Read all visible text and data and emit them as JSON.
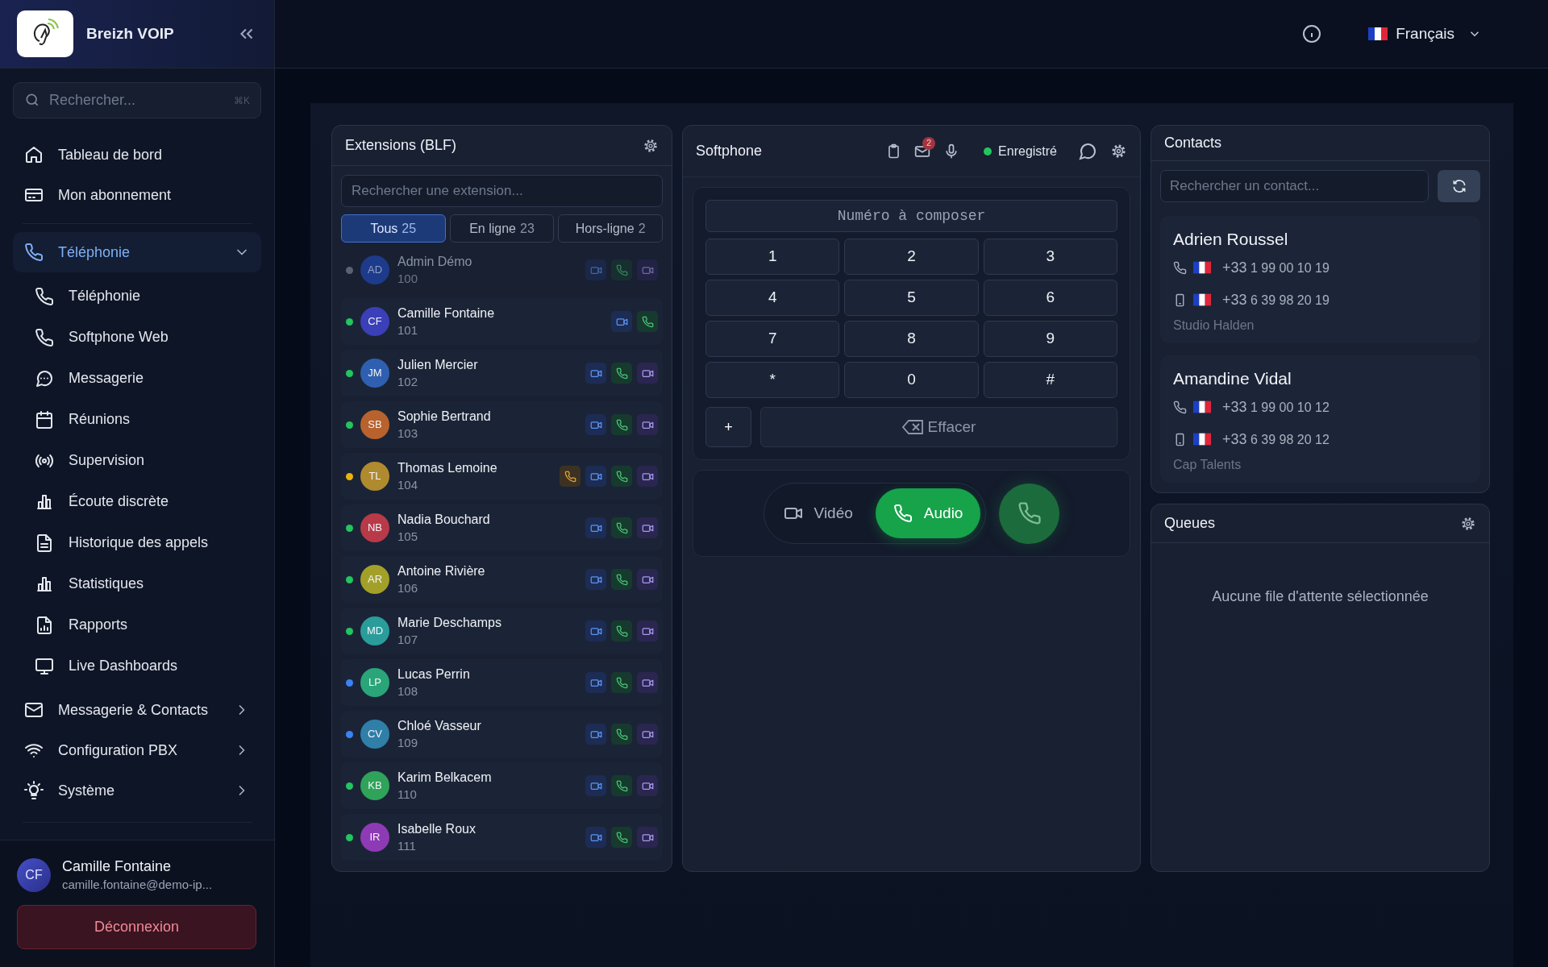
{
  "sidebar": {
    "brand": "Breizh VOIP",
    "search": {
      "placeholder": "Rechercher...",
      "shortcut": "⌘K"
    },
    "items": [
      {
        "label": "Tableau de bord",
        "selected": false
      },
      {
        "label": "Mon abonnement",
        "selected": false
      },
      {
        "label": "Téléphonie",
        "selected": true,
        "expanded": true,
        "children": [
          {
            "label": "Téléphonie",
            "selected": false
          },
          {
            "label": "Softphone Web",
            "selected": false
          },
          {
            "label": "Messagerie",
            "selected": false
          },
          {
            "label": "Réunions",
            "selected": false
          },
          {
            "label": "Supervision",
            "selected": false
          },
          {
            "label": "Écoute discrète",
            "selected": false
          },
          {
            "label": "Historique des appels",
            "selected": false
          },
          {
            "label": "Statistiques",
            "selected": false
          },
          {
            "label": "Rapports",
            "selected": false
          },
          {
            "label": "Live Dashboards",
            "selected": false
          }
        ]
      },
      {
        "label": "Messagerie & Contacts",
        "selected": false,
        "expanded": false
      },
      {
        "label": "Configuration PBX",
        "selected": false,
        "expanded": false
      },
      {
        "label": "Système",
        "selected": false,
        "expanded": false
      }
    ],
    "user": {
      "initials": "CF",
      "name": "Camille Fontaine",
      "email": "camille.fontaine@demo-ip..."
    },
    "logout": "Déconnexion"
  },
  "topbar": {
    "language": "Français"
  },
  "extensions": {
    "title": "Extensions (BLF)",
    "search": {
      "placeholder": "Rechercher une extension..."
    },
    "tabs": [
      {
        "label": "Tous",
        "count": "25",
        "selected": true
      },
      {
        "label": "En ligne",
        "count": "23",
        "selected": false
      },
      {
        "label": "Hors-ligne",
        "count": "2",
        "selected": false
      }
    ],
    "rows": [
      {
        "name": "Admin Démo",
        "ext": "100",
        "disabled": true,
        "color": "#5b6270",
        "avatar": {
          "initials": "AD",
          "color": "#1e3a8a"
        },
        "actions": [
          {
            "kind": "video"
          },
          {
            "kind": "call"
          },
          {
            "kind": "video_call"
          }
        ]
      },
      {
        "name": "Camille Fontaine",
        "ext": "101",
        "disabled": false,
        "color": "#22c55e",
        "avatar": {
          "initials": "CF",
          "color": "#3b3fb8"
        },
        "actions": [
          {
            "kind": "video"
          },
          {
            "kind": "call"
          }
        ]
      },
      {
        "name": "Julien Mercier",
        "ext": "102",
        "disabled": false,
        "color": "#22c55e",
        "avatar": {
          "initials": "JM",
          "color": "#2f5fb0"
        },
        "actions": [
          {
            "kind": "video"
          },
          {
            "kind": "call"
          },
          {
            "kind": "video_call"
          }
        ]
      },
      {
        "name": "Sophie Bertrand",
        "ext": "103",
        "disabled": false,
        "color": "#22c55e",
        "avatar": {
          "initials": "SB",
          "color": "#b8622d"
        },
        "actions": [
          {
            "kind": "video"
          },
          {
            "kind": "call"
          },
          {
            "kind": "video_call"
          }
        ]
      },
      {
        "name": "Thomas Lemoine",
        "ext": "104",
        "disabled": false,
        "color": "#eab308",
        "avatar": {
          "initials": "TL",
          "color": "#b08a2e"
        },
        "actions": [
          {
            "kind": "transfer"
          },
          {
            "kind": "video"
          },
          {
            "kind": "call"
          },
          {
            "kind": "video_call"
          }
        ]
      },
      {
        "name": "Nadia Bouchard",
        "ext": "105",
        "disabled": false,
        "color": "#22c55e",
        "avatar": {
          "initials": "NB",
          "color": "#b83a48"
        },
        "actions": [
          {
            "kind": "video"
          },
          {
            "kind": "call"
          },
          {
            "kind": "video_call"
          }
        ]
      },
      {
        "name": "Antoine Rivière",
        "ext": "106",
        "disabled": false,
        "color": "#22c55e",
        "avatar": {
          "initials": "AR",
          "color": "#a3a02a"
        },
        "actions": [
          {
            "kind": "video"
          },
          {
            "kind": "call"
          },
          {
            "kind": "video_call"
          }
        ]
      },
      {
        "name": "Marie Deschamps",
        "ext": "107",
        "disabled": false,
        "color": "#22c55e",
        "avatar": {
          "initials": "MD",
          "color": "#2a9d9a"
        },
        "actions": [
          {
            "kind": "video"
          },
          {
            "kind": "call"
          },
          {
            "kind": "video_call"
          }
        ]
      },
      {
        "name": "Lucas Perrin",
        "ext": "108",
        "disabled": false,
        "color": "#3b82f6",
        "avatar": {
          "initials": "LP",
          "color": "#2aa57a"
        },
        "actions": [
          {
            "kind": "video"
          },
          {
            "kind": "call"
          },
          {
            "kind": "video_call"
          }
        ]
      },
      {
        "name": "Chloé Vasseur",
        "ext": "109",
        "disabled": false,
        "color": "#3b82f6",
        "avatar": {
          "initials": "CV",
          "color": "#2f7fa8"
        },
        "actions": [
          {
            "kind": "video"
          },
          {
            "kind": "call"
          },
          {
            "kind": "video_call"
          }
        ]
      },
      {
        "name": "Karim Belkacem",
        "ext": "110",
        "disabled": false,
        "color": "#22c55e",
        "avatar": {
          "initials": "KB",
          "color": "#2fa35a"
        },
        "actions": [
          {
            "kind": "video"
          },
          {
            "kind": "call"
          },
          {
            "kind": "video_call"
          }
        ]
      },
      {
        "name": "Isabelle Roux",
        "ext": "111",
        "disabled": false,
        "color": "#22c55e",
        "avatar": {
          "initials": "IR",
          "color": "#8e3ab5"
        },
        "actions": [
          {
            "kind": "video"
          },
          {
            "kind": "call"
          },
          {
            "kind": "video_call"
          }
        ]
      }
    ]
  },
  "softphone": {
    "title": "Softphone",
    "mail_badge": "2",
    "registration": {
      "label": "Enregistré",
      "registered": true
    },
    "number": {
      "placeholder": "Numéro à composer"
    },
    "keys": [
      "1",
      "2",
      "3",
      "4",
      "5",
      "6",
      "7",
      "8",
      "9",
      "*",
      "0",
      "#"
    ],
    "plus": "+",
    "clear": "Effacer",
    "modes": [
      {
        "label": "Vidéo",
        "selected": false
      },
      {
        "label": "Audio",
        "selected": true
      }
    ]
  },
  "contacts": {
    "title": "Contacts",
    "search": {
      "placeholder": "Rechercher un contact..."
    },
    "list": [
      {
        "name": "Adrien Roussel",
        "company": "Studio Halden",
        "phones": [
          {
            "kind": "landline",
            "prefix": "+33",
            "number": "1 99 00 10 19"
          },
          {
            "kind": "mobile",
            "prefix": "+33",
            "number": "6 39 98 20 19"
          }
        ]
      },
      {
        "name": "Amandine Vidal",
        "company": "Cap Talents",
        "phones": [
          {
            "kind": "landline",
            "prefix": "+33",
            "number": "1 99 00 10 12"
          },
          {
            "kind": "mobile",
            "prefix": "+33",
            "number": "6 39 98 20 12"
          }
        ]
      }
    ]
  },
  "queues": {
    "title": "Queues",
    "empty": "Aucune file d'attente sélectionnée"
  }
}
